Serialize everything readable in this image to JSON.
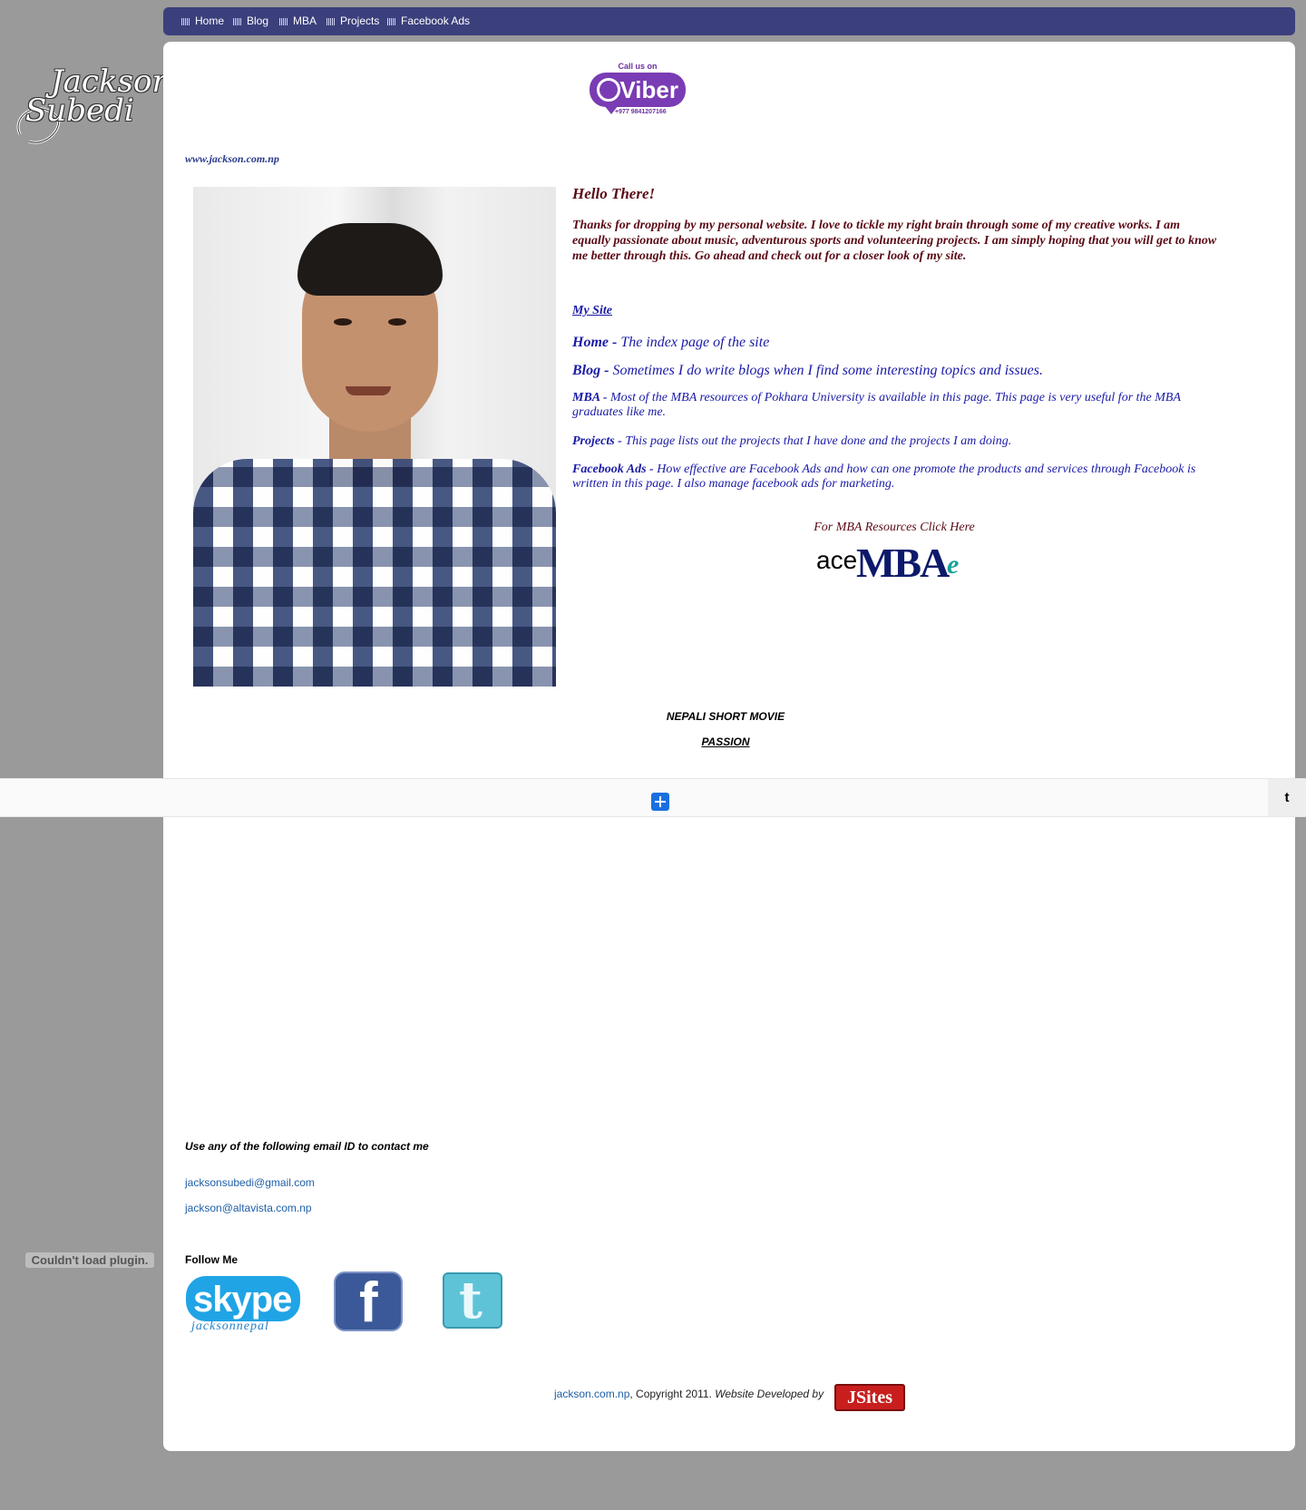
{
  "nav": {
    "items": [
      {
        "label": "Home"
      },
      {
        "label": "Blog"
      },
      {
        "label": "MBA"
      },
      {
        "label": "Projects"
      },
      {
        "label": "Facebook Ads"
      }
    ]
  },
  "logo": {
    "line1": "Jackson",
    "line2": "Subedi"
  },
  "viber": {
    "call_text": "Call us on",
    "brand": "Viber",
    "phone": "+977 9841207166"
  },
  "site_url": "www.jackson.com.np",
  "intro": {
    "greeting": "Hello There!",
    "text": "Thanks for dropping by my personal website. I love to tickle my right brain through some of my creative works. I am equally passionate about music, adventurous sports and volunteering projects. I am simply hoping that you will get to know me better through this. Go ahead and check out for a closer look of my site."
  },
  "my_site": {
    "heading": "My Site",
    "items": [
      {
        "name": "Home -",
        "desc": " The index page of the site"
      },
      {
        "name": "Blog -",
        "desc": " Sometimes I do write blogs when I find some interesting topics and issues."
      },
      {
        "name": "MBA -",
        "desc": " Most of the MBA resources of Pokhara University is available in this page. This page is very useful for the MBA graduates like me."
      },
      {
        "name": "Projects -",
        "desc": " This page lists out the projects that I have done and the projects I am doing."
      },
      {
        "name": "Facebook Ads -",
        "desc": " How effective are Facebook Ads and how can one promote the products and services through Facebook is written in this page. I also manage facebook ads for marketing."
      }
    ]
  },
  "mba_resources": {
    "link_text": "For MBA Resources Click Here",
    "logo_ace": "ace",
    "logo_mba": "MBA",
    "logo_e": "e"
  },
  "movie": {
    "title": "NEPALI SHORT MOVIE",
    "link": "PASSION "
  },
  "share_bar": {
    "twitter_tab": "t"
  },
  "contact": {
    "title": "Use any of the following email ID to contact me",
    "emails": [
      "jacksonsubedi@gmail.com",
      "jackson@altavista.com.np"
    ]
  },
  "follow": {
    "title": "Follow Me",
    "skype_word": "skype",
    "skype_handle": "jacksonnepal",
    "facebook_letter": "f",
    "twitter_letter": "t"
  },
  "footer": {
    "link": "jackson.com.np",
    "copyright": ", Copyright 2011. ",
    "developed": "Website Developed by",
    "badge": "JSites"
  },
  "plugin_error": "Couldn't load plugin.",
  "colors": {
    "page_bg": "#9a9a9a",
    "nav_bg": "#3b3f7c",
    "intro_text": "#5a0a14",
    "site_links": "#1a1aa8",
    "email_links": "#1f5fa8"
  }
}
